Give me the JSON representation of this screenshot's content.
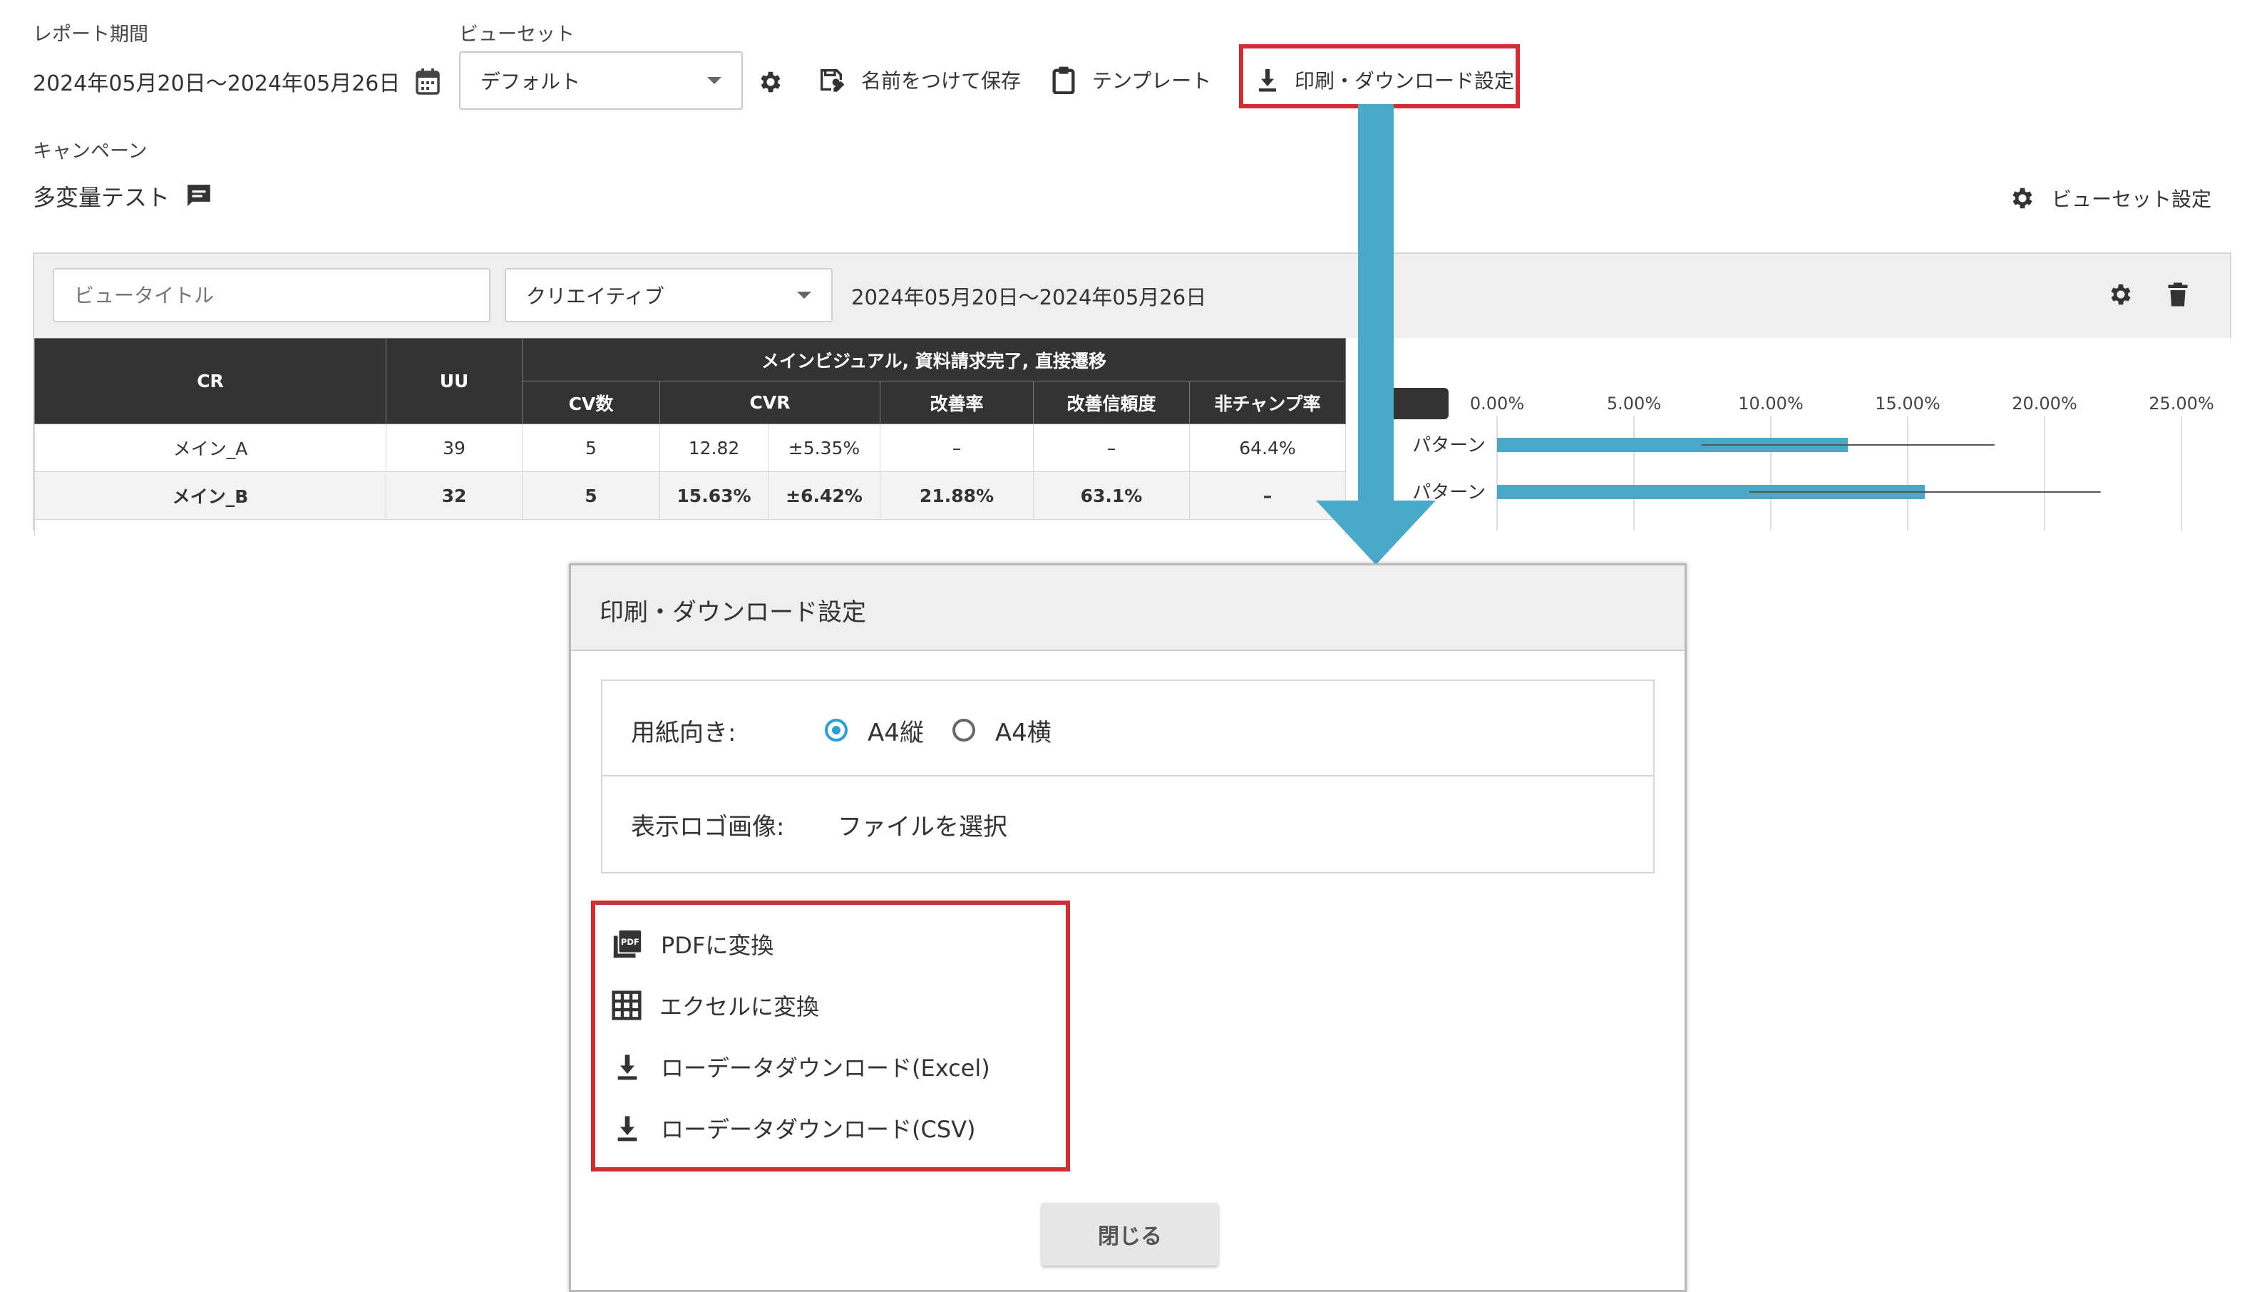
{
  "header": {
    "report_period_label": "レポート期間",
    "report_period_value": "2024年05月20日〜2024年05月26日",
    "viewset_label": "ビューセット",
    "viewset_value": "デフォルト",
    "save_label": "名前をつけて保存",
    "template_label": "テンプレート",
    "print_label": "印刷・ダウンロード設定"
  },
  "campaign": {
    "label": "キャンペーン",
    "name": "多変量テスト",
    "viewset_settings_label": "ビューセット設定"
  },
  "view": {
    "title_placeholder": "ビュータイトル",
    "dimension_value": "クリエイティブ",
    "date_range": "2024年05月20日〜2024年05月26日",
    "table": {
      "col_cr": "CR",
      "col_uu": "UU",
      "group_header": "メインビジュアル, 資料請求完了, 直接遷移",
      "col_cv": "CV数",
      "col_cvr": "CVR",
      "col_improve": "改善率",
      "col_reliability": "改善信頼度",
      "col_nonchamp": "非チャンプ率",
      "rows": [
        {
          "cr": "メイン_A",
          "uu": "39",
          "cv": "5",
          "cvr": "12.82",
          "cvr_err": "±5.35%",
          "improve": "–",
          "reliability": "–",
          "nonchamp": "64.4%"
        },
        {
          "cr": "メイン_B",
          "uu": "32",
          "cv": "5",
          "cvr": "15.63%",
          "cvr_err": "±6.42%",
          "improve": "21.88%",
          "reliability": "63.1%",
          "nonchamp": "–"
        }
      ]
    },
    "chart": {
      "ticks": [
        "0.00%",
        "5.00%",
        "10.00%",
        "15.00%",
        "20.00%",
        "25.00%"
      ],
      "row_labels": [
        "パターン",
        "パターン"
      ],
      "bars": [
        {
          "value": 12.82,
          "err_low": 7.47,
          "err_high": 18.17
        },
        {
          "value": 15.63,
          "err_low": 9.21,
          "err_high": 22.05
        }
      ],
      "axis_max": 25,
      "bar_color": "#4aa9c7"
    }
  },
  "modal": {
    "title": "印刷・ダウンロード設定",
    "orientation_label": "用紙向き:",
    "orientation_options": [
      "A4縦",
      "A4横"
    ],
    "logo_label": "表示ロゴ画像:",
    "logo_button": "ファイルを選択",
    "actions": [
      "PDFに変換",
      "エクセルに変換",
      "ローデータダウンロード(Excel)",
      "ローデータダウンロード(CSV)"
    ],
    "close_label": "閉じる"
  }
}
